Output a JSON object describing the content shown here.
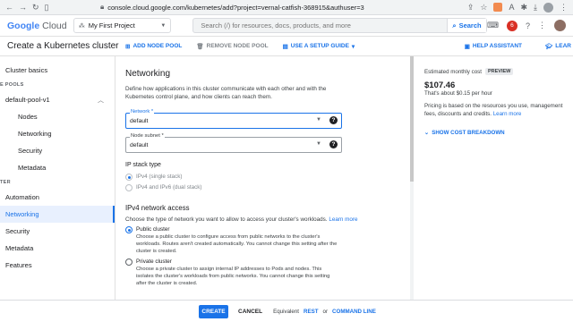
{
  "browser": {
    "url": "console.cloud.google.com/kubernetes/add?project=vernal-catfish-368915&authuser=3",
    "notification_count": "6"
  },
  "topbar": {
    "logo_google": "Google",
    "logo_cloud": "Cloud",
    "project": "My First Project",
    "search_placeholder": "Search (/) for resources, docs, products, and more",
    "search_button": "Search"
  },
  "page": {
    "title": "Create a Kubernetes cluster",
    "actions": {
      "add_node_pool": "ADD NODE POOL",
      "remove_node_pool": "REMOVE NODE POOL",
      "setup_guide": "USE A SETUP GUIDE",
      "help_assistant": "HELP ASSISTANT",
      "learn": "LEAR"
    }
  },
  "sidebar": {
    "cluster_basics": "Cluster basics",
    "node_pools_section": "E POOLS",
    "pool_name": "default-pool-v1",
    "pool_items": [
      "Nodes",
      "Networking",
      "Security",
      "Metadata"
    ],
    "cluster_section": "TER",
    "cluster_items": [
      "Automation",
      "Networking",
      "Security",
      "Metadata",
      "Features"
    ]
  },
  "form": {
    "heading": "Networking",
    "description": "Define how applications in this cluster communicate with each other and with the Kubernetes control plane, and how clients can reach them.",
    "network_label": "Network *",
    "network_value": "default",
    "subnet_label": "Node subnet *",
    "subnet_value": "default",
    "ip_stack_heading": "IP stack type",
    "ip_stack_options": [
      "IPv4 (single stack)",
      "IPv4 and IPv6 (dual stack)"
    ],
    "ipv4_heading": "IPv4 network access",
    "ipv4_desc": "Choose the type of network you want to allow to access your cluster's workloads.",
    "learn_more": "Learn more",
    "public_title": "Public cluster",
    "public_desc": "Choose a public cluster to configure access from public networks to the cluster's workloads. Routes aren't created automatically. You cannot change this setting after the cluster is created.",
    "private_title": "Private cluster",
    "private_desc": "Choose a private cluster to assign internal IP addresses to Pods and nodes. This isolates the cluster's workloads from public networks. You cannot change this setting after the cluster is created."
  },
  "cost_panel": {
    "label": "Estimated monthly cost",
    "badge": "PREVIEW",
    "price": "$107.46",
    "hourly": "That's about $0.15 per hour",
    "pricing_note": "Pricing is based on the resources you use, management fees, discounts and credits.",
    "learn_more": "Learn more",
    "breakdown": "SHOW COST BREAKDOWN"
  },
  "bottom": {
    "create": "CREATE",
    "cancel": "CANCEL",
    "equivalent": "Equivalent",
    "rest": "REST",
    "or": "or",
    "command_line": "COMMAND LINE"
  }
}
